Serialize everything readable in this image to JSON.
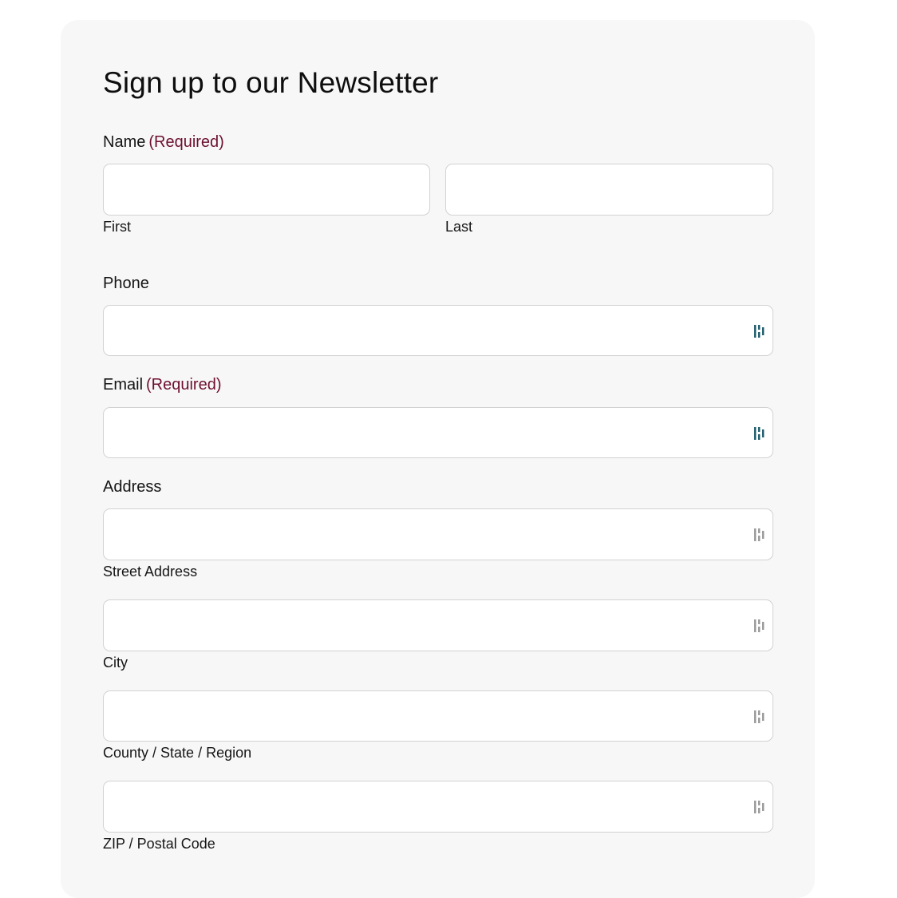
{
  "form": {
    "title": "Sign up to our Newsletter",
    "required_text": "(Required)",
    "name": {
      "label": "Name",
      "first_label": "First",
      "last_label": "Last",
      "first_value": "",
      "last_value": ""
    },
    "phone": {
      "label": "Phone",
      "value": ""
    },
    "email": {
      "label": "Email",
      "value": ""
    },
    "address": {
      "label": "Address",
      "street_label": "Street Address",
      "city_label": "City",
      "region_label": "County / State / Region",
      "zip_label": "ZIP / Postal Code"
    }
  },
  "icons": {
    "active_field_icon": "password-manager-icon",
    "inactive_field_icon": "password-manager-icon"
  },
  "colors": {
    "required": "#6e1030",
    "icon_active": "#1f5d6e",
    "icon_inactive": "#9a9a9a",
    "panel_bg": "#f7f7f7"
  }
}
